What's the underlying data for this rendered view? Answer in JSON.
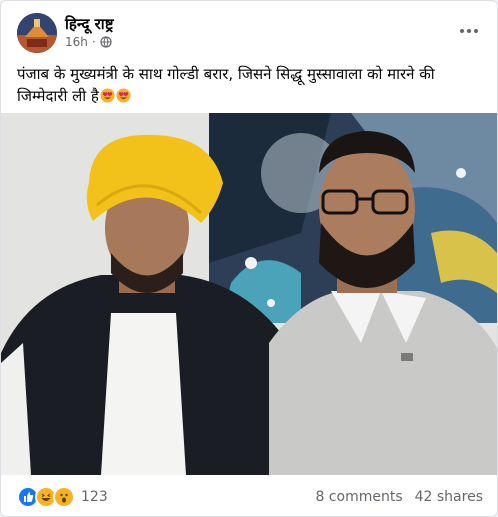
{
  "post": {
    "author": "हिन्दू राष्ट्र",
    "time": "16h",
    "separator": "·",
    "privacy_icon": "globe-icon",
    "more_icon": "more-horizontal-icon",
    "text": "पंजाब के मुख्यमंत्री के साथ गोल्डी बरार, जिसने सिद्धू मुस्सावाला को मारने की जिम्मेदारी ली है",
    "text_emojis": [
      "heart-eyes-emoji",
      "heart-eyes-emoji"
    ],
    "image_alt": "photo-two-men"
  },
  "footer": {
    "reactions": [
      "like-reaction",
      "haha-reaction",
      "wow-reaction"
    ],
    "reaction_count": "123",
    "comments": "8 comments",
    "shares": "42 shares"
  },
  "colors": {
    "like_blue": "#1877f2",
    "emoji_yellow": "#f7b125",
    "text_primary": "#050505",
    "text_secondary": "#65676b"
  }
}
